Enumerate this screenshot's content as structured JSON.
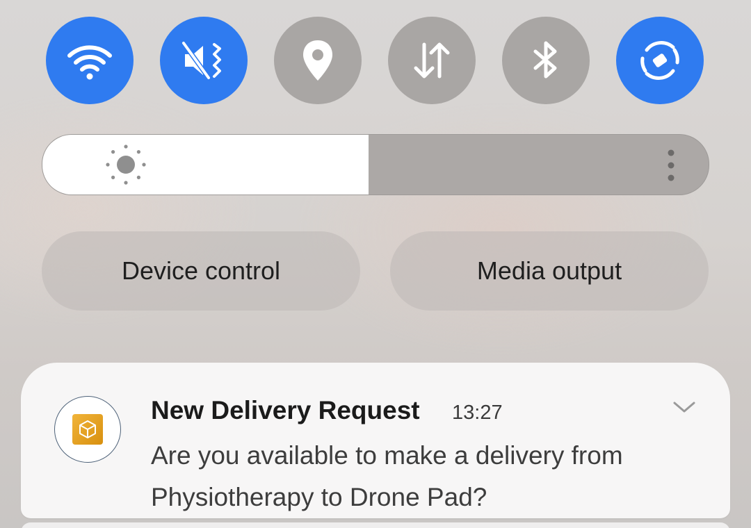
{
  "quick_toggles": [
    {
      "name": "wifi-icon",
      "state": "on"
    },
    {
      "name": "vibrate-icon",
      "state": "on"
    },
    {
      "name": "location-icon",
      "state": "off"
    },
    {
      "name": "mobile-data-icon",
      "state": "off"
    },
    {
      "name": "bluetooth-icon",
      "state": "off"
    },
    {
      "name": "auto-rotate-icon",
      "state": "on"
    }
  ],
  "brightness": {
    "level": 0.49,
    "icon": "sun-icon",
    "more_icon": "more-vertical-icon"
  },
  "buttons": {
    "device_control": "Device control",
    "media_output": "Media output"
  },
  "notification": {
    "title": "New Delivery Request",
    "time": "13:27",
    "body": "Are you available to make a delivery from Physiotherapy to Drone Pad?",
    "app_icon": "delivery-app-icon",
    "expand_icon": "chevron-down-icon"
  },
  "colors": {
    "toggle_on": "#2f7bf0",
    "toggle_off": "#a9a6a4",
    "app_icon": "#e3a123"
  }
}
